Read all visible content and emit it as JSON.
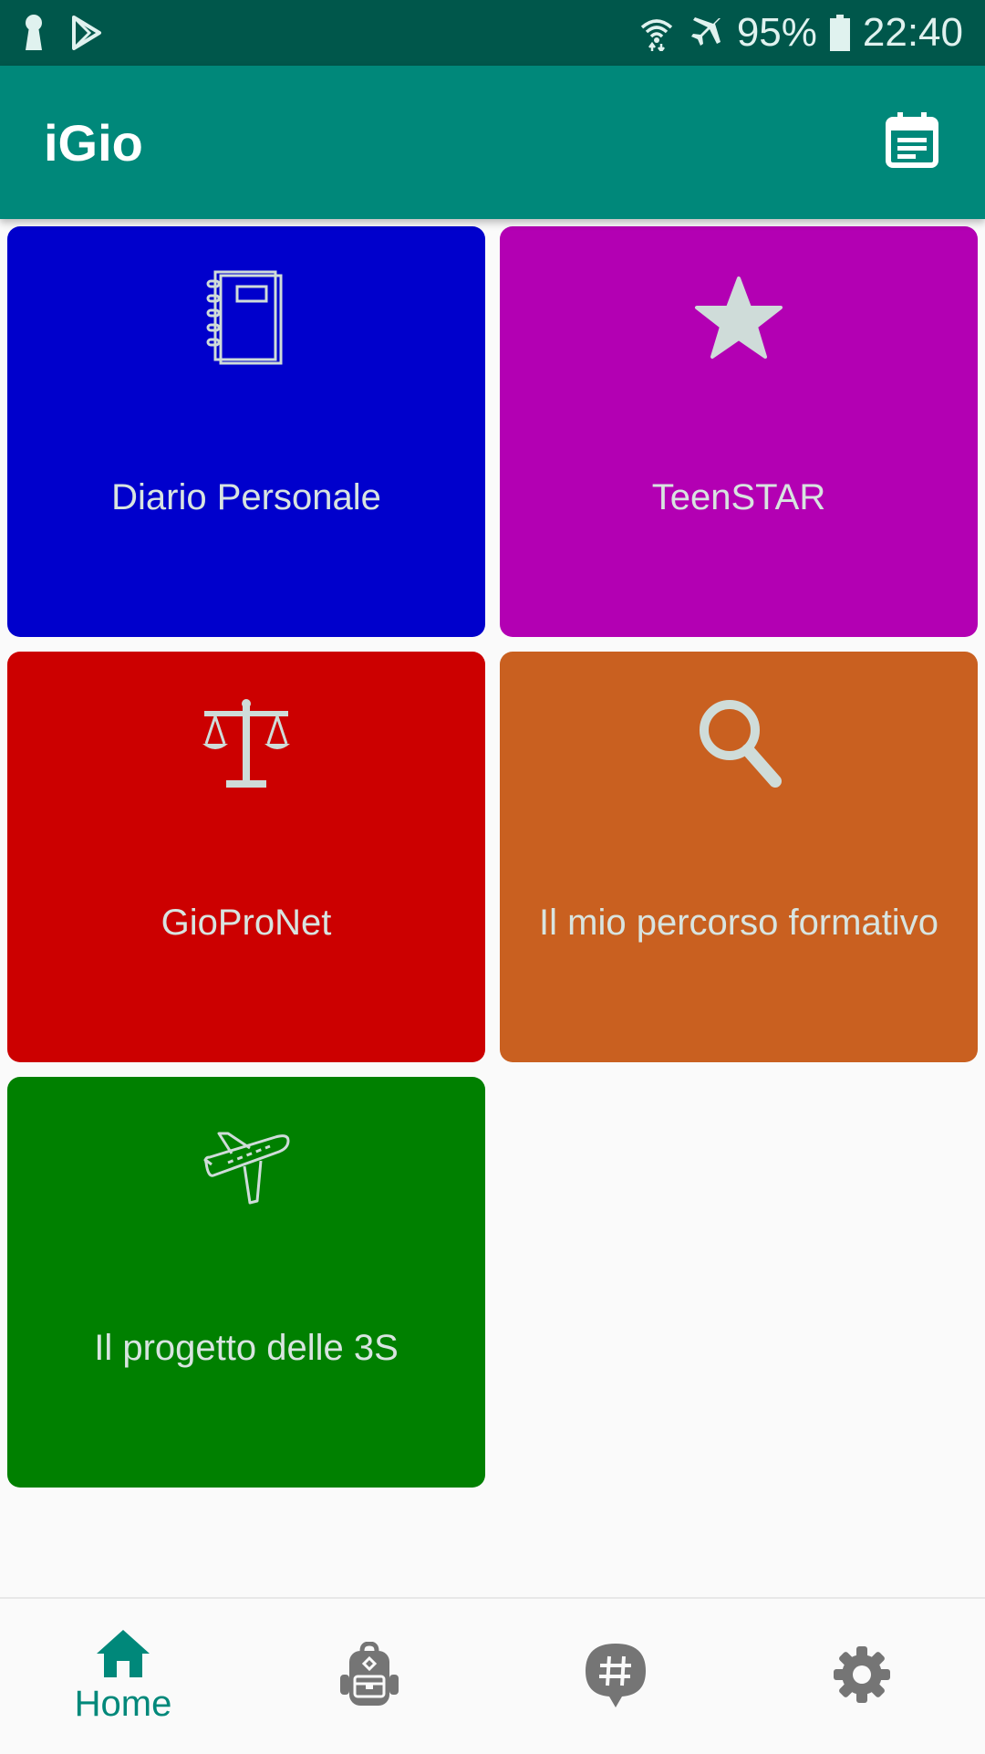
{
  "status_bar": {
    "battery": "95%",
    "time": "22:40",
    "icons": [
      "keyhole-icon",
      "play-store-icon",
      "wifi-icon",
      "airplane-mode-icon",
      "battery-icon"
    ]
  },
  "app_bar": {
    "title": "iGio",
    "action_icon": "calendar-icon"
  },
  "tiles": [
    {
      "label": "Diario Personale",
      "color": "#0000cc",
      "icon": "notebook-icon"
    },
    {
      "label": "TeenSTAR",
      "color": "#b300b3",
      "icon": "star-icon"
    },
    {
      "label": "GioProNet",
      "color": "#cc0000",
      "icon": "scales-icon"
    },
    {
      "label": "Il mio percorso formativo",
      "color": "#c96020",
      "icon": "magnifier-icon"
    },
    {
      "label": "Il progetto delle 3S",
      "color": "#008000",
      "icon": "airplane-icon"
    }
  ],
  "bottom_nav": {
    "items": [
      {
        "label": "Home",
        "icon": "home-icon",
        "active": true
      },
      {
        "label": "",
        "icon": "backpack-icon",
        "active": false
      },
      {
        "label": "",
        "icon": "hashtag-chat-icon",
        "active": false
      },
      {
        "label": "",
        "icon": "gear-icon",
        "active": false
      }
    ]
  },
  "colors": {
    "status_bar": "#00574b",
    "app_bar": "#00887a",
    "icon_light": "#cfdcd9",
    "nav_active": "#00887a",
    "nav_inactive": "#757575"
  }
}
